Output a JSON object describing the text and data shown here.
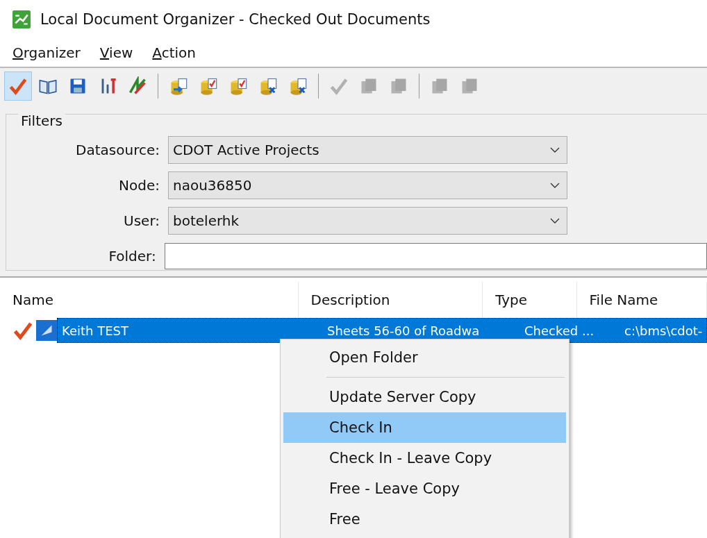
{
  "window": {
    "title": "Local Document Organizer - Checked Out Documents"
  },
  "menu_bar": [
    "Organizer",
    "View",
    "Action"
  ],
  "toolbar": [
    {
      "kind": "check",
      "pressed": true,
      "disabled": false
    },
    {
      "kind": "book",
      "pressed": false,
      "disabled": false
    },
    {
      "kind": "save",
      "pressed": false,
      "disabled": false
    },
    {
      "kind": "tools",
      "pressed": false,
      "disabled": false
    },
    {
      "kind": "flags",
      "pressed": false,
      "disabled": false
    },
    {
      "kind": "sep"
    },
    {
      "kind": "db-doc",
      "pressed": false,
      "disabled": false
    },
    {
      "kind": "db-check",
      "pressed": false,
      "disabled": false
    },
    {
      "kind": "db-check",
      "pressed": false,
      "disabled": false
    },
    {
      "kind": "db-x",
      "pressed": false,
      "disabled": false
    },
    {
      "kind": "db-x",
      "pressed": false,
      "disabled": false
    },
    {
      "kind": "sep"
    },
    {
      "kind": "check",
      "pressed": false,
      "disabled": true
    },
    {
      "kind": "pages",
      "pressed": false,
      "disabled": true
    },
    {
      "kind": "pages",
      "pressed": false,
      "disabled": true
    },
    {
      "kind": "sep"
    },
    {
      "kind": "pages",
      "pressed": false,
      "disabled": true
    },
    {
      "kind": "pages",
      "pressed": false,
      "disabled": true
    }
  ],
  "filters": {
    "title": "Filters",
    "fields": [
      {
        "kind": "dropdown",
        "label": "Datasource:",
        "value": "CDOT Active Projects"
      },
      {
        "kind": "dropdown",
        "label": "Node:",
        "value": "naou36850"
      },
      {
        "kind": "dropdown",
        "label": "User:",
        "value": "botelerhk"
      },
      {
        "kind": "text",
        "label": "Folder:"
      }
    ]
  },
  "table": {
    "columns": [
      "Name",
      "Description",
      "Type",
      "File Name"
    ],
    "rows": [
      {
        "selected": true,
        "cells": [
          "Keith TEST",
          "Sheets 56-60 of Roadwa",
          "Checked ...",
          "c:\\bms\\cdot-"
        ]
      }
    ]
  },
  "context_menu": [
    {
      "kind": "item",
      "label": "Open Folder",
      "selected": false
    },
    {
      "kind": "sep"
    },
    {
      "kind": "item",
      "label": "Update Server Copy",
      "selected": false
    },
    {
      "kind": "item",
      "label": "Check In",
      "selected": true
    },
    {
      "kind": "item",
      "label": "Check In - Leave Copy",
      "selected": false
    },
    {
      "kind": "item",
      "label": "Free - Leave Copy",
      "selected": false
    },
    {
      "kind": "item",
      "label": "Free",
      "selected": false
    }
  ]
}
